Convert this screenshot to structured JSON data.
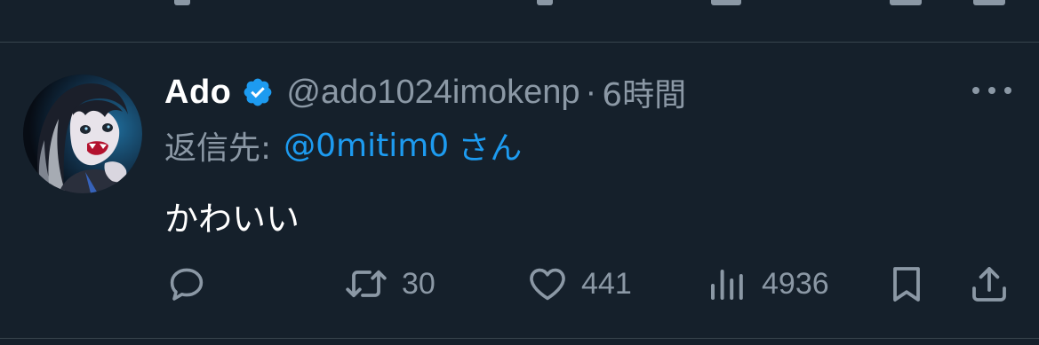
{
  "tweet": {
    "display_name": "Ado",
    "handle": "@ado1024imokenp",
    "separator": "·",
    "time": "6時間",
    "reply_prefix": "返信先:",
    "reply_target": "@0mitim0",
    "reply_suffix": "さん",
    "text": "かわいい",
    "verified": true
  },
  "actions": {
    "reply": {
      "icon": "reply-icon",
      "count": ""
    },
    "retweet": {
      "icon": "retweet-icon",
      "count": "30"
    },
    "like": {
      "icon": "heart-icon",
      "count": "441"
    },
    "views": {
      "icon": "views-icon",
      "count": "4936"
    },
    "bookmark": {
      "icon": "bookmark-icon"
    },
    "share": {
      "icon": "share-icon"
    }
  },
  "colors": {
    "background": "#15202b",
    "divider": "#38444d",
    "secondary_text": "#8b98a5",
    "accent": "#1d9bf0",
    "primary_text": "#ffffff"
  }
}
